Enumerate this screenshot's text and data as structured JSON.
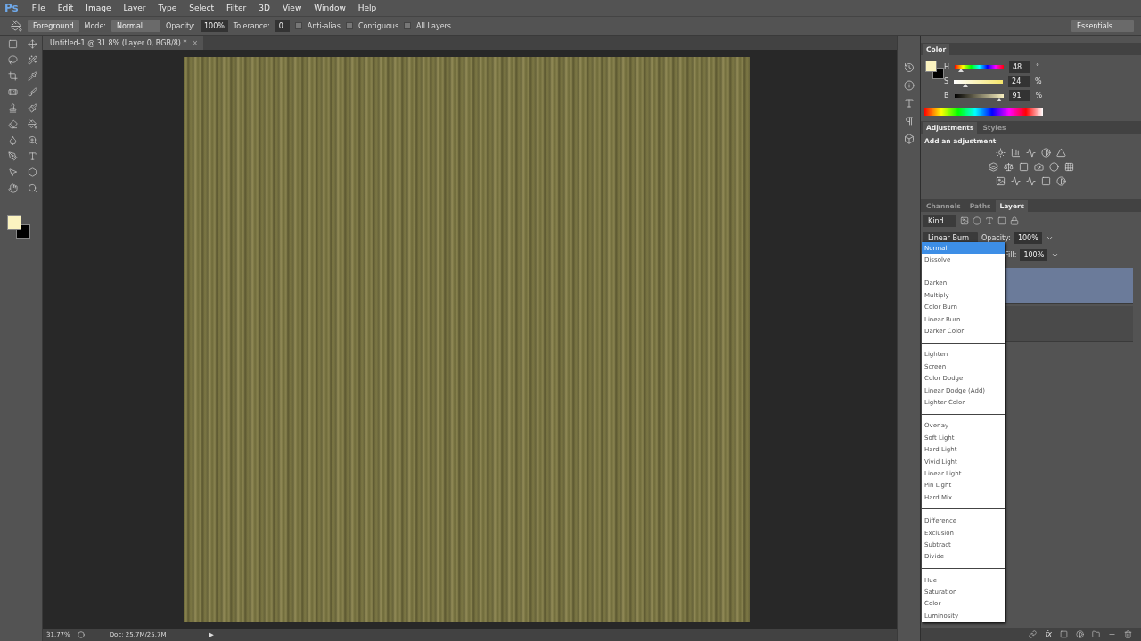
{
  "app_logo": "Ps",
  "menu": [
    "File",
    "Edit",
    "Image",
    "Layer",
    "Type",
    "Select",
    "Filter",
    "3D",
    "View",
    "Window",
    "Help"
  ],
  "options_bar": {
    "preset": "Foreground",
    "mode_label": "Mode:",
    "mode": "Normal",
    "opacity_label": "Opacity:",
    "opacity": "100%",
    "tolerance_label": "Tolerance:",
    "tolerance": "0",
    "checks": [
      {
        "label": "Anti-alias",
        "checked": false
      },
      {
        "label": "Contiguous",
        "checked": false
      },
      {
        "label": "All Layers",
        "checked": false
      }
    ]
  },
  "workspace": "Essentials",
  "doc_tab": {
    "title": "Untitled-1 @ 31.8% (Layer 0, RGB/8) *",
    "close": "×"
  },
  "color_panel": {
    "title": "Color",
    "channels": [
      {
        "label": "H",
        "value": "48",
        "unit": "°",
        "level": 0.13
      },
      {
        "label": "S",
        "value": "24",
        "unit": "%",
        "level": 0.24
      },
      {
        "label": "B",
        "value": "91",
        "unit": "%",
        "level": 0.91
      }
    ]
  },
  "adjustments_panel": {
    "tabs": [
      {
        "label": "Adjustments",
        "selected": true
      },
      {
        "label": "Styles",
        "selected": false
      }
    ],
    "heading": "Add an adjustment"
  },
  "layers_panel": {
    "tabs": [
      {
        "label": "Channels",
        "selected": false
      },
      {
        "label": "Paths",
        "selected": false
      },
      {
        "label": "Layers",
        "selected": true
      }
    ],
    "filter": "Kind",
    "blend_mode": "Linear Burn",
    "opacity_label": "Opacity:",
    "opacity": "100%",
    "fill_label": "Fill:",
    "fill": "100%",
    "layers": [
      {
        "selected": true
      },
      {
        "selected": false
      }
    ],
    "fx_label": "fx"
  },
  "blend_menu": [
    [
      {
        "label": "Normal",
        "selected": true
      },
      {
        "label": "Dissolve",
        "selected": false
      }
    ],
    [
      {
        "label": "Darken",
        "selected": false
      },
      {
        "label": "Multiply",
        "selected": false
      },
      {
        "label": "Color Burn",
        "selected": false
      },
      {
        "label": "Linear Burn",
        "selected": false
      },
      {
        "label": "Darker Color",
        "selected": false
      }
    ],
    [
      {
        "label": "Lighten",
        "selected": false
      },
      {
        "label": "Screen",
        "selected": false
      },
      {
        "label": "Color Dodge",
        "selected": false
      },
      {
        "label": "Linear Dodge (Add)",
        "selected": false
      },
      {
        "label": "Lighter Color",
        "selected": false
      }
    ],
    [
      {
        "label": "Overlay",
        "selected": false
      },
      {
        "label": "Soft Light",
        "selected": false
      },
      {
        "label": "Hard Light",
        "selected": false
      },
      {
        "label": "Vivid Light",
        "selected": false
      },
      {
        "label": "Linear Light",
        "selected": false
      },
      {
        "label": "Pin Light",
        "selected": false
      },
      {
        "label": "Hard Mix",
        "selected": false
      }
    ],
    [
      {
        "label": "Difference",
        "selected": false
      },
      {
        "label": "Exclusion",
        "selected": false
      },
      {
        "label": "Subtract",
        "selected": false
      },
      {
        "label": "Divide",
        "selected": false
      }
    ],
    [
      {
        "label": "Hue",
        "selected": false
      },
      {
        "label": "Saturation",
        "selected": false
      },
      {
        "label": "Color",
        "selected": false
      },
      {
        "label": "Luminosity",
        "selected": false
      }
    ]
  ],
  "status_bar": {
    "zoom": "31.77%",
    "doc": "Doc: 25.7M/25.7M",
    "arrow": "▶"
  }
}
